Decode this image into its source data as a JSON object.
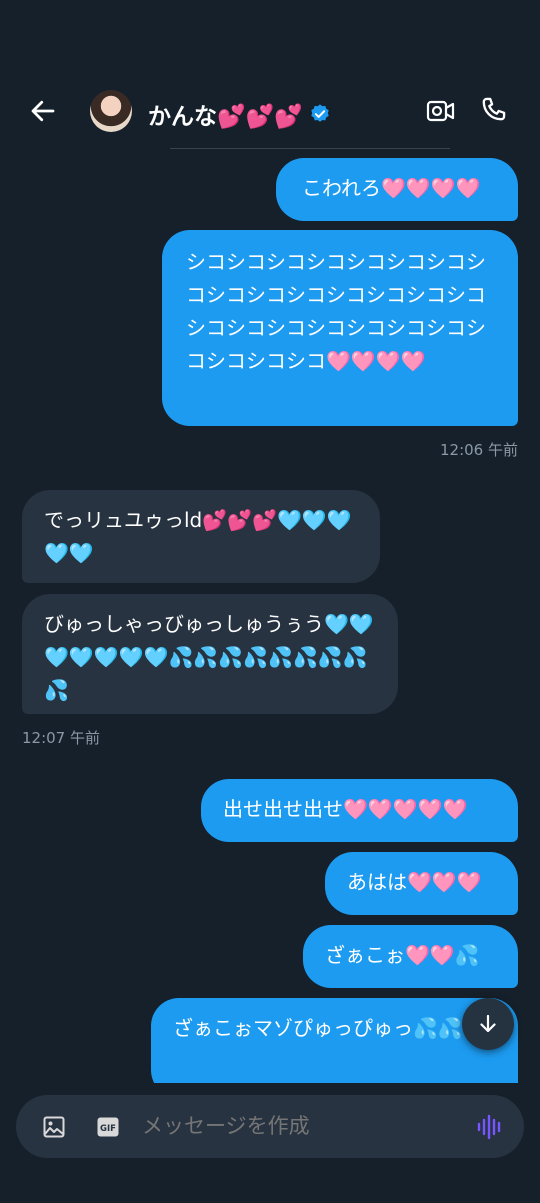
{
  "header": {
    "name": "かんな💕💕💕",
    "back_icon": "arrow-left-icon",
    "video_icon": "video-camera-icon",
    "phone_icon": "phone-icon",
    "verified_icon": "verified-badge-icon"
  },
  "messages": [
    {
      "dir": "out",
      "text": "こわれろ🩷🩷🩷🩷"
    },
    {
      "dir": "out",
      "text": "シコシコシコシコシコシコシコシコシコシコシコシコシコシコシコシコシコシコシコシコシコシコシコシコシコシコ🩷🩷🩷🩷"
    },
    {
      "dir": "in",
      "text": "でっリュユゥっld💕💕💕🩵🩵🩵🩵🩵"
    },
    {
      "dir": "in",
      "text": "びゅっしゃっびゅっしゅうぅう🩵🩵🩵🩵🩵🩵🩵💦💦💦💦💦💦💦💦💦"
    },
    {
      "dir": "out",
      "text": "出せ出せ出せ🩷🩷🩷🩷🩷"
    },
    {
      "dir": "out",
      "text": "あはは🩷🩷🩷"
    },
    {
      "dir": "out",
      "text": "ざぁこぉ🩷🩷💦"
    },
    {
      "dir": "out",
      "text": "ざぁこぉマゾぴゅっぴゅっ💦💦"
    }
  ],
  "timestamps": {
    "t1": "12:06 午前",
    "t2": "12:07 午前"
  },
  "composer": {
    "placeholder": "メッセージを作成",
    "image_icon": "image-icon",
    "gif_icon": "gif-icon",
    "voice_icon": "voice-wave-icon"
  },
  "scroll_button_icon": "arrow-down-icon",
  "colors": {
    "background": "#15202b",
    "outgoing_bubble": "#1d9bf0",
    "incoming_bubble": "#273340",
    "timestamp": "#8b98a5",
    "voice_accent": "#7856ff"
  }
}
